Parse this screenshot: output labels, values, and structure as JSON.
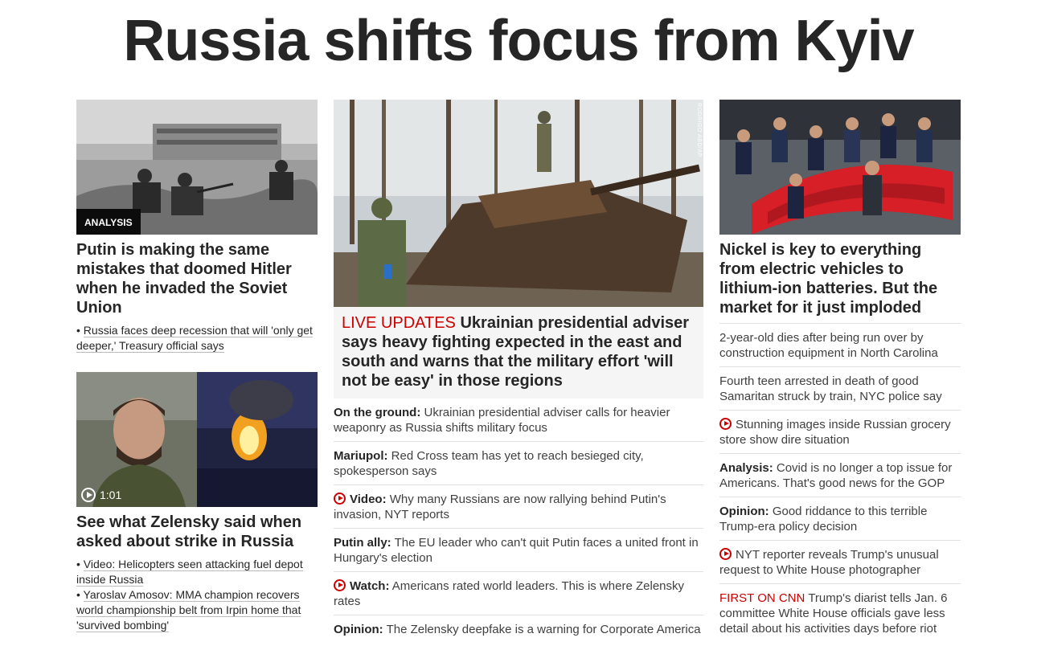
{
  "page": {
    "headline": "Russia shifts focus from Kyiv"
  },
  "left": {
    "story1": {
      "tag": "ANALYSIS",
      "title": "Putin is making the same mistakes that doomed Hitler when he invaded the Soviet Union",
      "related": "Russia faces deep recession that will 'only get deeper,' Treasury official says"
    },
    "story2": {
      "duration": "1:01",
      "title": "See what Zelensky said when asked about strike in Russia",
      "related": [
        "Video: Helicopters seen attacking fuel depot inside Russia",
        "Yaroslav Amosov: MMA champion recovers world championship belt from Irpin home that 'survived bombing'"
      ]
    }
  },
  "middle": {
    "photo_credit": "RODRIGO ABD/AP",
    "live_label": "LIVE UPDATES",
    "title": "Ukrainian presidential adviser says heavy fighting expected in the east and south and warns that the military effort 'will not be easy' in those regions",
    "items": [
      {
        "label": "On the ground:",
        "text": "Ukrainian presidential adviser calls for heavier weaponry as Russia shifts military focus",
        "video": false
      },
      {
        "label": "Mariupol:",
        "text": "Red Cross team has yet to reach besieged city, spokesperson says",
        "video": false
      },
      {
        "label": "Video:",
        "text": "Why many Russians are now rallying behind Putin's invasion, NYT reports",
        "video": true
      },
      {
        "label": "Putin ally:",
        "text": "The EU leader who can't quit Putin faces a united front in Hungary's election",
        "video": false
      },
      {
        "label": "Watch:",
        "text": "Americans rated world leaders. This is where Zelensky rates",
        "video": true
      },
      {
        "label": "Opinion:",
        "text": "The Zelensky deepfake is a warning for Corporate America",
        "video": false
      }
    ]
  },
  "right": {
    "title": "Nickel is key to everything from electric vehicles to lithium-ion batteries. But the market for it just imploded",
    "items": [
      {
        "label": "",
        "text": "2-year-old dies after being run over by construction equipment in North Carolina"
      },
      {
        "label": "",
        "text": "Fourth teen arrested in death of good Samaritan struck by train, NYC police say"
      },
      {
        "label": "",
        "text": "Stunning images inside Russian grocery store show dire situation"
      },
      {
        "label": "Analysis:",
        "text": "Covid is no longer a top issue for Americans. That's good news for the GOP"
      },
      {
        "label": "Opinion:",
        "text": "Good riddance to this terrible Trump-era policy decision"
      },
      {
        "label": "",
        "text": "NYT reporter reveals Trump's unusual request to White House photographer"
      },
      {
        "label": "FIRST ON CNN",
        "text": "Trump's diarist tells Jan. 6 committee White House officials gave less detail about his activities days before riot"
      }
    ]
  }
}
